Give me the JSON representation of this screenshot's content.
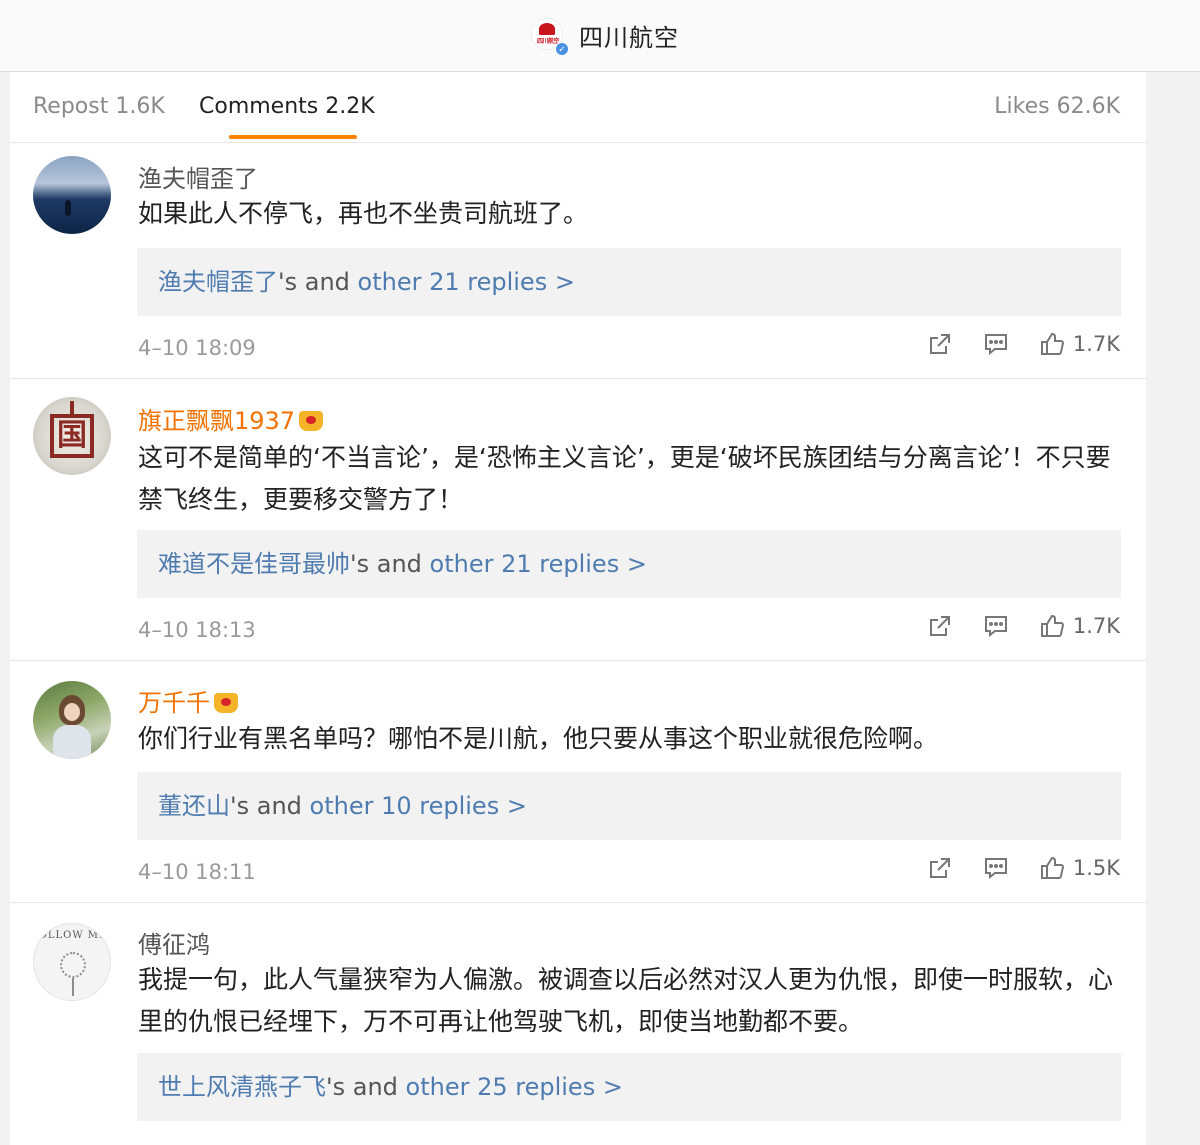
{
  "header": {
    "title": "四川航空",
    "logo_text": "四川航空"
  },
  "tabs": {
    "repost": "Repost 1.6K",
    "comments": "Comments 2.2K",
    "likes": "Likes 62.6K"
  },
  "comments": [
    {
      "username": "渔夫帽歪了",
      "text": "如果此人不停飞，再也不坐贵司航班了。",
      "reply_name": "渔夫帽歪了",
      "reply_mid": "'s and ",
      "reply_more": "other 21 replies >",
      "time": "4–10 18:09",
      "likes": "1.7K"
    },
    {
      "username": "旗正飘飘1937",
      "text": "这可不是简单的‘不当言论’，是‘恐怖主义言论’，更是‘破坏民族团结与分离言论’！不只要禁飞终生，更要移交警方了！",
      "reply_name": "难道不是佳哥最帅",
      "reply_mid": "'s and ",
      "reply_more": "other 21 replies >",
      "time": "4–10 18:13",
      "likes": "1.7K"
    },
    {
      "username": "万千千",
      "text": "你们行业有黑名单吗？哪怕不是川航，他只要从事这个职业就很危险啊。",
      "reply_name": "董还山",
      "reply_mid": "'s and ",
      "reply_more": "other 10 replies >",
      "time": "4–10 18:11",
      "likes": "1.5K"
    },
    {
      "username": "傅征鸿",
      "text": "我提一句，此人气量狭窄为人偏激。被调查以后必然对汉人更为仇恨，即使一时服软，心里的仇恨已经埋下，万不可再让他驾驶飞机，即使当地勤都不要。",
      "reply_name": "世上风清燕子飞",
      "reply_mid": "'s and ",
      "reply_more": "other 25 replies >",
      "avatar_text": "OLLOW ME"
    }
  ],
  "icons": [
    "share-icon",
    "comment-icon",
    "thumbs-up-icon",
    "crown-icon",
    "verified-icon"
  ],
  "colors": {
    "accent": "#ff8200",
    "link": "#4f7cb0",
    "vip": "#f27100"
  }
}
